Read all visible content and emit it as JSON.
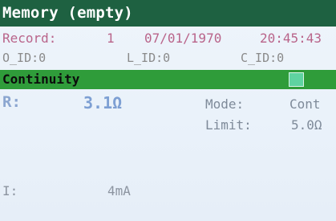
{
  "header": {
    "title": "Memory (empty)"
  },
  "record": {
    "label": "Record:",
    "number": "1",
    "date": "07/01/1970",
    "time": "20:45:43"
  },
  "ids": {
    "o_id": "O_ID:0",
    "l_id": "L_ID:0",
    "c_id": "C_ID:0"
  },
  "test": {
    "name": "Continuity",
    "indicator_color": "#5fd3a1"
  },
  "measurement": {
    "r_label": "R:",
    "r_value": "3.1Ω",
    "i_label": "I:",
    "i_value": "4mA"
  },
  "settings": {
    "mode_label": "Mode:",
    "mode_value": "Cont",
    "limit_label": "Limit:",
    "limit_value": "5.0Ω"
  },
  "colors": {
    "title_bar": "#1e6141",
    "section_bar": "#2f9c3a",
    "record_text": "#b9648a"
  }
}
